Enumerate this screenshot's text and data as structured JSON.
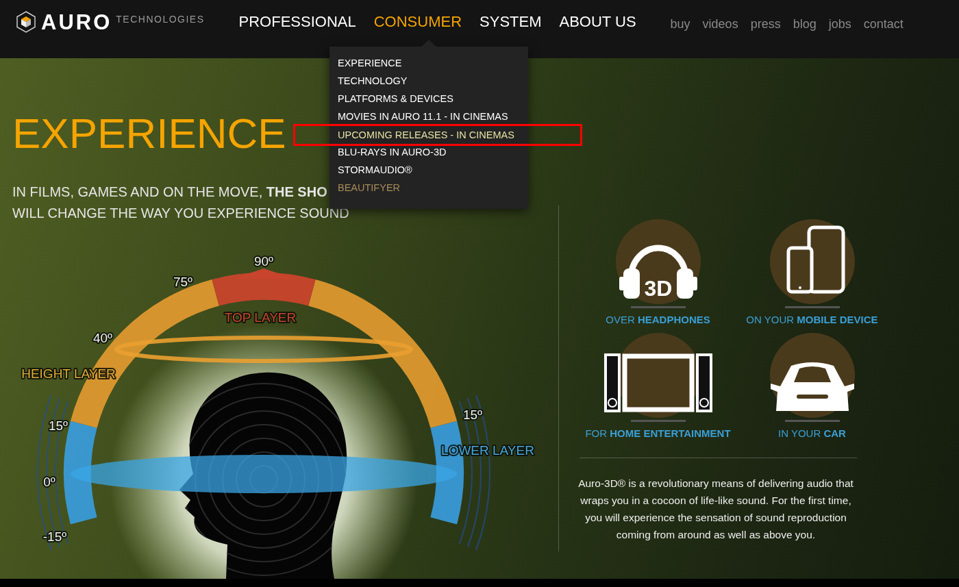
{
  "header": {
    "logo": {
      "wordmark": "AURO",
      "tagline": "TECHNOLOGIES"
    },
    "main_nav": [
      {
        "label": "PROFESSIONAL",
        "selected": false
      },
      {
        "label": "CONSUMER",
        "selected": true
      },
      {
        "label": "SYSTEM",
        "selected": false
      },
      {
        "label": "ABOUT US",
        "selected": false
      }
    ],
    "secondary_nav": [
      "buy",
      "videos",
      "press",
      "blog",
      "jobs",
      "contact"
    ]
  },
  "dropdown": {
    "items": [
      {
        "label": "EXPERIENCE",
        "hovered": false,
        "dimmed": false,
        "annotated": false
      },
      {
        "label": "TECHNOLOGY",
        "hovered": false,
        "dimmed": false,
        "annotated": false
      },
      {
        "label": "PLATFORMS & DEVICES",
        "hovered": false,
        "dimmed": false,
        "annotated": false
      },
      {
        "label": "MOVIES IN AURO 11.1 - IN CINEMAS",
        "hovered": false,
        "dimmed": false,
        "annotated": false
      },
      {
        "label": "UPCOMING RELEASES - IN CINEMAS",
        "hovered": true,
        "dimmed": false,
        "annotated": true
      },
      {
        "label": "BLU-RAYS IN AURO-3D",
        "hovered": false,
        "dimmed": false,
        "annotated": false
      },
      {
        "label": "STORMAUDIO®",
        "hovered": false,
        "dimmed": false,
        "annotated": false
      },
      {
        "label": "BEAUTIFYER",
        "hovered": false,
        "dimmed": true,
        "annotated": false
      }
    ]
  },
  "hero": {
    "title": "EXPERIENCE",
    "subtitle_lines": [
      "IN FILMS, GAMES AND ON THE MOVE, **THE SHO**",
      "WILL CHANGE THE WAY YOU EXPERIENCE SOUND"
    ]
  },
  "infographic": {
    "angle_labels": [
      "90º",
      "75º",
      "40º",
      "15º",
      "0º",
      "-15º",
      "15º"
    ],
    "layer_labels": [
      {
        "text": "TOP LAYER",
        "color": "#c8442c"
      },
      {
        "text": "HEIGHT LAYER",
        "color": "#e0a838"
      },
      {
        "text": "LOWER LAYER",
        "color": "#46a6dc"
      }
    ]
  },
  "features": [
    {
      "kind": "headphones",
      "caption": "OVER **HEADPHONES**",
      "icon_text": "3D"
    },
    {
      "kind": "mobile",
      "caption": "ON YOUR **MOBILE DEVICE**"
    },
    {
      "kind": "home-theater",
      "caption": "FOR **HOME ENTERTAINMENT**"
    },
    {
      "kind": "car",
      "caption": "IN YOUR **CAR**"
    }
  ],
  "description": "Auro-3D® is a revolutionary means of delivering audio that wraps you in a cocoon of life-like sound. For the first time, you will experience the sensation of sound reproduction coming from around as well as above you."
}
